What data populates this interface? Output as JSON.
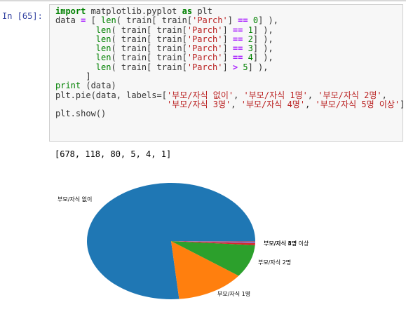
{
  "prompt": "In [65]:",
  "code_lines": [
    [
      [
        "kw",
        "import"
      ],
      [
        "t",
        " matplotlib.pyplot "
      ],
      [
        "kw",
        "as"
      ],
      [
        "t",
        " plt"
      ]
    ],
    [
      [
        "t",
        "data "
      ],
      [
        "op",
        "="
      ],
      [
        "t",
        " [ "
      ],
      [
        "bi",
        "len"
      ],
      [
        "t",
        "( train[ train["
      ],
      [
        "str",
        "'Parch'"
      ],
      [
        "t",
        "] "
      ],
      [
        "op",
        "=="
      ],
      [
        "t",
        " "
      ],
      [
        "num",
        "0"
      ],
      [
        "t",
        "] ),"
      ]
    ],
    [
      [
        "t",
        "        "
      ],
      [
        "bi",
        "len"
      ],
      [
        "t",
        "( train[ train["
      ],
      [
        "str",
        "'Parch'"
      ],
      [
        "t",
        "] "
      ],
      [
        "op",
        "=="
      ],
      [
        "t",
        " "
      ],
      [
        "num",
        "1"
      ],
      [
        "t",
        "] ),"
      ]
    ],
    [
      [
        "t",
        "        "
      ],
      [
        "bi",
        "len"
      ],
      [
        "t",
        "( train[ train["
      ],
      [
        "str",
        "'Parch'"
      ],
      [
        "t",
        "] "
      ],
      [
        "op",
        "=="
      ],
      [
        "t",
        " "
      ],
      [
        "num",
        "2"
      ],
      [
        "t",
        "] ),"
      ]
    ],
    [
      [
        "t",
        "        "
      ],
      [
        "bi",
        "len"
      ],
      [
        "t",
        "( train[ train["
      ],
      [
        "str",
        "'Parch'"
      ],
      [
        "t",
        "] "
      ],
      [
        "op",
        "=="
      ],
      [
        "t",
        " "
      ],
      [
        "num",
        "3"
      ],
      [
        "t",
        "] ),"
      ]
    ],
    [
      [
        "t",
        "        "
      ],
      [
        "bi",
        "len"
      ],
      [
        "t",
        "( train[ train["
      ],
      [
        "str",
        "'Parch'"
      ],
      [
        "t",
        "] "
      ],
      [
        "op",
        "=="
      ],
      [
        "t",
        " "
      ],
      [
        "num",
        "4"
      ],
      [
        "t",
        "] ),"
      ]
    ],
    [
      [
        "t",
        "        "
      ],
      [
        "bi",
        "len"
      ],
      [
        "t",
        "( train[ train["
      ],
      [
        "str",
        "'Parch'"
      ],
      [
        "t",
        "] "
      ],
      [
        "op",
        ">"
      ],
      [
        "t",
        " "
      ],
      [
        "num",
        "5"
      ],
      [
        "t",
        "] ),"
      ]
    ],
    [
      [
        "t",
        "      ]"
      ]
    ],
    [
      [
        "bi",
        "print"
      ],
      [
        "t",
        " (data)"
      ]
    ],
    [
      [
        "t",
        "plt.pie(data, labels=["
      ],
      [
        "str",
        "'부모/자식 없이'"
      ],
      [
        "t",
        ", "
      ],
      [
        "str",
        "'부모/자식 1명'"
      ],
      [
        "t",
        ", "
      ],
      [
        "str",
        "'부모/자식 2명'"
      ],
      [
        "t",
        ","
      ]
    ],
    [
      [
        "t",
        "                      "
      ],
      [
        "str",
        "'부모/자식 3명'"
      ],
      [
        "t",
        ", "
      ],
      [
        "str",
        "'부모/자식 4명'"
      ],
      [
        "t",
        ", "
      ],
      [
        "str",
        "'부모/자식 5명 이상'"
      ],
      [
        "t",
        "])"
      ]
    ],
    [
      [
        "t",
        "plt.show()"
      ]
    ]
  ],
  "output_text": "[678, 118, 80, 5, 4, 1]",
  "chart_data": {
    "type": "pie",
    "labels": [
      "부모/자식 없이",
      "부모/자식 1명",
      "부모/자식 2명",
      "부모/자식 3명",
      "부모/자식 4명",
      "부모/자식 5명 이상"
    ],
    "values": [
      678,
      118,
      80,
      5,
      4,
      1
    ],
    "colors": [
      "#1f77b4",
      "#ff7f0e",
      "#2ca02c",
      "#d62728",
      "#9467bd",
      "#8c564b"
    ]
  }
}
